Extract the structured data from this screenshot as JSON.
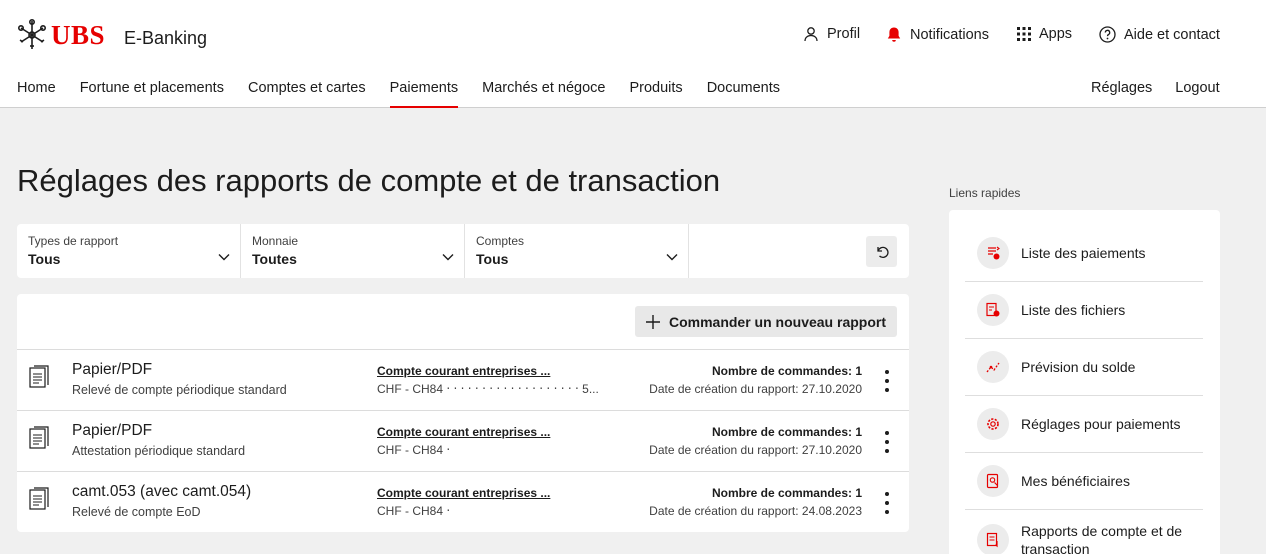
{
  "brand": {
    "logo_text": "UBS",
    "app_title": "E-Banking",
    "accent_color": "#e60000"
  },
  "utility_nav": {
    "profile": "Profil",
    "notifications": "Notifications",
    "apps": "Apps",
    "help": "Aide et contact"
  },
  "main_nav": {
    "items": [
      "Home",
      "Fortune et placements",
      "Comptes et cartes",
      "Paiements",
      "Marchés et négoce",
      "Produits",
      "Documents"
    ],
    "active": "Paiements",
    "right_items": [
      "Réglages",
      "Logout"
    ]
  },
  "page": {
    "title": "Réglages des rapports de compte et de transaction"
  },
  "filters": [
    {
      "label": "Types de rapport",
      "value": "Tous"
    },
    {
      "label": "Monnaie",
      "value": "Toutes"
    },
    {
      "label": "Comptes",
      "value": "Tous"
    }
  ],
  "actions": {
    "order_new_report": "Commander un nouveau rapport"
  },
  "reports": [
    {
      "title": "Papier/PDF",
      "subtitle": "Relevé de compte périodique standard",
      "account": "Compte courant entreprises ...",
      "account_number": "CHF - CH84 ‧ ‧ ‧ ‧ ‧ ‧ ‧ ‧ ‧ ‧ ‧ ‧ ‧ ‧ ‧ ‧ ‧ ‧ ‧ 5...",
      "orders": "Nombre de commandes: 1",
      "created": "Date de création du rapport: 27.10.2020"
    },
    {
      "title": "Papier/PDF",
      "subtitle": "Attestation périodique standard",
      "account": "Compte courant entreprises ...",
      "account_number": "CHF - CH84 ‧",
      "orders": "Nombre de commandes: 1",
      "created": "Date de création du rapport: 27.10.2020"
    },
    {
      "title": "camt.053 (avec camt.054)",
      "subtitle": "Relevé de compte EoD",
      "account": "Compte courant entreprises ...",
      "account_number": "CHF - CH84 ‧",
      "orders": "Nombre de commandes: 1",
      "created": "Date de création du rapport: 24.08.2023"
    }
  ],
  "quick_links": {
    "heading": "Liens rapides",
    "items": [
      {
        "label": "Liste des paiements",
        "icon": "payments-list-icon"
      },
      {
        "label": "Liste des fichiers",
        "icon": "files-list-icon"
      },
      {
        "label": "Prévision du solde",
        "icon": "balance-forecast-icon"
      },
      {
        "label": "Réglages pour paiements",
        "icon": "settings-gear-icon"
      },
      {
        "label": "Mes bénéficiaires",
        "icon": "beneficiaries-icon"
      },
      {
        "label": "Rapports de compte et de transaction",
        "icon": "reports-icon"
      }
    ]
  }
}
